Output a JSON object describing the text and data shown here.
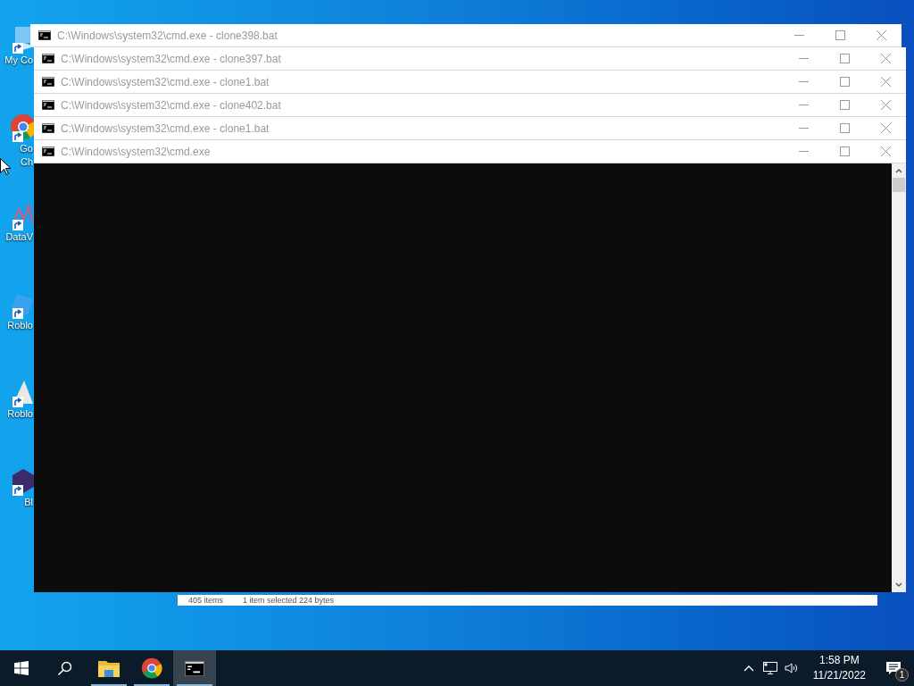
{
  "desktop_icons": [
    {
      "kind": "computer",
      "lines": [
        "My Co"
      ]
    },
    {
      "kind": "chrome",
      "lines": [
        "Go",
        "Ch"
      ]
    },
    {
      "kind": "chart",
      "lines": [
        "DataV"
      ]
    },
    {
      "kind": "roblox",
      "lines": [
        "Roblo"
      ]
    },
    {
      "kind": "studio",
      "lines": [
        "Roblo"
      ]
    },
    {
      "kind": "hexagon",
      "lines": [
        "Bl"
      ]
    }
  ],
  "explorer_status": {
    "items": "405 items",
    "selection": "1 item selected  224 bytes"
  },
  "windows": [
    {
      "kind": "titlebar",
      "title": "C:\\Windows\\system32\\cmd.exe - clone398.bat"
    },
    {
      "kind": "titlebar",
      "title": "C:\\Windows\\system32\\cmd.exe - clone397.bat"
    },
    {
      "kind": "titlebar",
      "title": "C:\\Windows\\system32\\cmd.exe - clone1.bat"
    },
    {
      "kind": "titlebar",
      "title": "C:\\Windows\\system32\\cmd.exe - clone402.bat"
    },
    {
      "kind": "titlebar",
      "title": "C:\\Windows\\system32\\cmd.exe - clone1.bat"
    },
    {
      "kind": "console",
      "title": "C:\\Windows\\system32\\cmd.exe"
    }
  ],
  "taskbar": {
    "items": [
      {
        "kind": "start",
        "running": false,
        "selected": false
      },
      {
        "kind": "search",
        "running": false,
        "selected": false
      },
      {
        "kind": "explorer",
        "running": true,
        "selected": false
      },
      {
        "kind": "chrome",
        "running": true,
        "selected": false
      },
      {
        "kind": "console",
        "running": true,
        "selected": true
      }
    ],
    "time": "1:58 PM",
    "date": "11/21/2022",
    "notification_count": "1"
  }
}
